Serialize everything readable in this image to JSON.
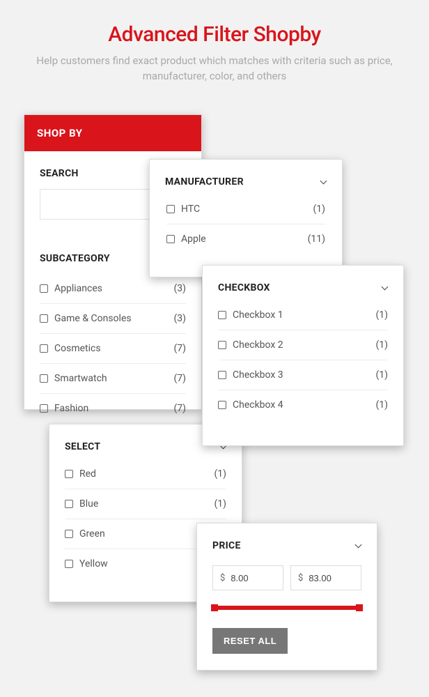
{
  "hero": {
    "title": "Advanced Filter Shopby",
    "subtitle": "Help customers find exact product which matches with criteria such as price, manufacturer, color, and others"
  },
  "shopby": {
    "header": "SHOP BY",
    "search_title": "SEARCH",
    "search_value": "",
    "subcat_title": "SUBCATEGORY",
    "subcat_items": [
      {
        "label": "Appliances",
        "count": "(3)"
      },
      {
        "label": "Game & Consoles",
        "count": "(3)"
      },
      {
        "label": "Cosmetics",
        "count": "(7)"
      },
      {
        "label": "Smartwatch",
        "count": "(7)"
      },
      {
        "label": "Fashion",
        "count": "(7)"
      }
    ]
  },
  "manufacturer": {
    "title": "MANUFACTURER",
    "items": [
      {
        "label": "HTC",
        "count": "(1)"
      },
      {
        "label": "Apple",
        "count": "(11)"
      }
    ]
  },
  "checkbox": {
    "title": "CHECKBOX",
    "items": [
      {
        "label": "Checkbox 1",
        "count": "(1)"
      },
      {
        "label": "Checkbox 2",
        "count": "(1)"
      },
      {
        "label": "Checkbox 3",
        "count": "(1)"
      },
      {
        "label": "Checkbox 4",
        "count": "(1)"
      }
    ]
  },
  "select": {
    "title": "SELECT",
    "items": [
      {
        "label": "Red",
        "count": "(1)"
      },
      {
        "label": "Blue",
        "count": "(1)"
      },
      {
        "label": "Green",
        "count": ""
      },
      {
        "label": "Yellow",
        "count": ""
      }
    ]
  },
  "price": {
    "title": "PRICE",
    "currency": "$",
    "min": "8.00",
    "max": "83.00",
    "reset_label": "RESET ALL"
  }
}
